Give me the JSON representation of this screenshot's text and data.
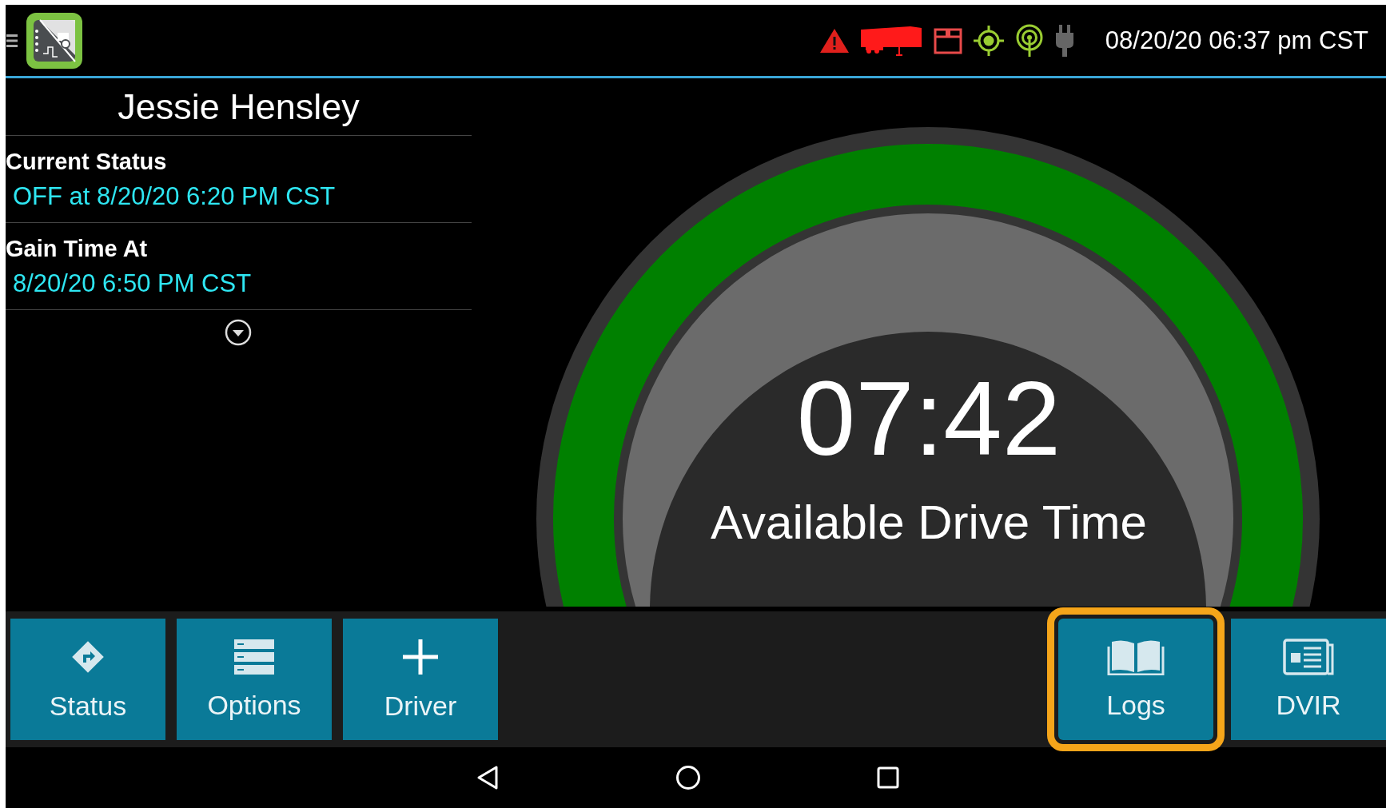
{
  "header": {
    "datetime": "08/20/20 06:37 pm CST"
  },
  "driver": {
    "name": "Jessie Hensley"
  },
  "info": [
    {
      "label": "Current Status",
      "value": "OFF at 8/20/20 6:20 PM CST"
    },
    {
      "label": "Gain Time At",
      "value": "8/20/20 6:50 PM CST"
    }
  ],
  "gauge": {
    "time": "07:42",
    "caption": "Available Drive Time"
  },
  "left_buttons": [
    {
      "label": "Status",
      "kind": "status",
      "selected": false
    },
    {
      "label": "Options",
      "kind": "options",
      "selected": false
    },
    {
      "label": "Driver",
      "kind": "driver",
      "selected": false
    }
  ],
  "right_buttons": [
    {
      "label": "Logs",
      "kind": "logs",
      "selected": true
    },
    {
      "label": "DVIR",
      "kind": "dvir",
      "selected": false
    }
  ]
}
